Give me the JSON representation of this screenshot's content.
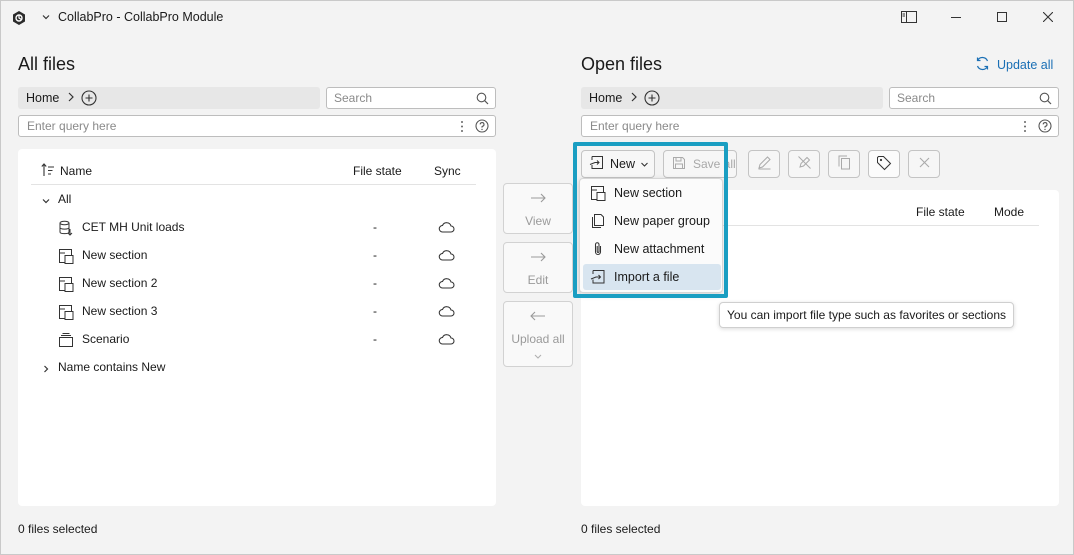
{
  "window": {
    "title": "CollabPro - CollabPro Module"
  },
  "left_pane": {
    "title": "All files",
    "breadcrumb": "Home",
    "search_placeholder": "Search",
    "query_placeholder": "Enter query here",
    "columns": {
      "name": "Name",
      "file_state": "File state",
      "sync": "Sync"
    },
    "groups": [
      {
        "label": "All",
        "expanded": true,
        "rows": [
          {
            "name": "CET MH Unit loads",
            "icon": "database-icon",
            "state": "-",
            "sync": "cloud-icon"
          },
          {
            "name": "New section",
            "icon": "section-icon",
            "state": "-",
            "sync": "cloud-icon"
          },
          {
            "name": "New section 2",
            "icon": "section-icon",
            "state": "-",
            "sync": "cloud-icon"
          },
          {
            "name": "New section 3",
            "icon": "section-icon",
            "state": "-",
            "sync": "cloud-icon"
          },
          {
            "name": "Scenario",
            "icon": "scenario-icon",
            "state": "-",
            "sync": "cloud-icon"
          }
        ]
      },
      {
        "label": "Name contains New",
        "expanded": false
      }
    ],
    "status": "0 files selected"
  },
  "middle_buttons": {
    "view": "View",
    "edit": "Edit",
    "upload_all": "Upload all"
  },
  "right_pane": {
    "title": "Open files",
    "update_all": "Update all",
    "breadcrumb": "Home",
    "search_placeholder": "Search",
    "query_placeholder": "Enter query here",
    "toolbar": {
      "new_label": "New",
      "save_all_label": "Save all"
    },
    "columns": {
      "file_state": "File state",
      "mode": "Mode"
    },
    "status": "0 files selected"
  },
  "new_menu": {
    "items": [
      {
        "label": "New section",
        "icon": "section-icon"
      },
      {
        "label": "New paper group",
        "icon": "paper-group-icon"
      },
      {
        "label": "New attachment",
        "icon": "paperclip-icon"
      },
      {
        "label": "Import a file",
        "icon": "import-icon",
        "active": true
      }
    ]
  },
  "tooltip": {
    "text": "You can import file type such as favorites or sections"
  },
  "colors": {
    "accent": "#1a9ec2",
    "link": "#1a6fb5",
    "menu_active": "#d8e5f0"
  }
}
